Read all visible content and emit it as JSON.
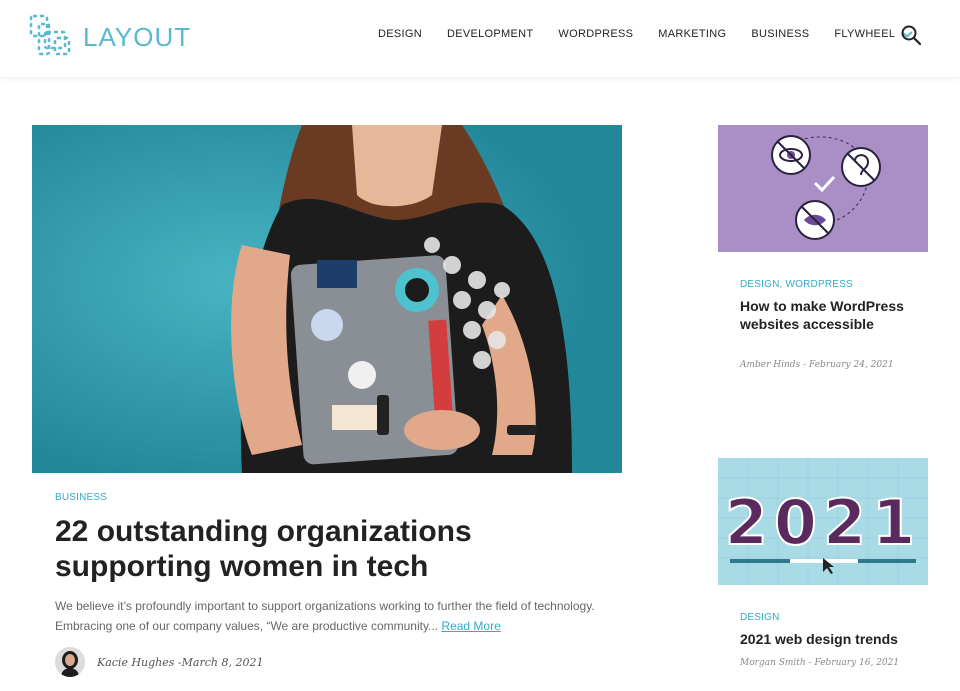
{
  "brand": {
    "name": "LAYOUT",
    "accent": "#5ab9cf"
  },
  "nav": {
    "items": [
      "DESIGN",
      "DEVELOPMENT",
      "WORDPRESS",
      "MARKETING",
      "BUSINESS",
      "FLYWHEEL"
    ],
    "dropdown_icon": "chevron-down-icon",
    "search_icon": "search-icon"
  },
  "featured": {
    "category": "BUSINESS",
    "title": "22 outstanding organizations supporting women in tech",
    "excerpt": "We believe it’s profoundly important to support organizations working to further the field of technology. Embracing one of our company values, “We are productive community...",
    "read_more": "Read More",
    "byline": "Kacie Hughes -March 8, 2021"
  },
  "side_posts": [
    {
      "category": "DESIGN, WORDPRESS",
      "title": "How to make WordPress websites accessible",
      "meta": "Amber Hinds - February 24, 2021"
    },
    {
      "category": "DESIGN",
      "title": "2021 web design trends",
      "meta": "Morgan Smith - February 16, 2021",
      "image_text": "2021"
    }
  ],
  "colors": {
    "link": "#37a9c1",
    "hero_bg": "#2e9dad",
    "card1_bg": "#a98fc6",
    "card2_bg": "#a9dbe7"
  }
}
